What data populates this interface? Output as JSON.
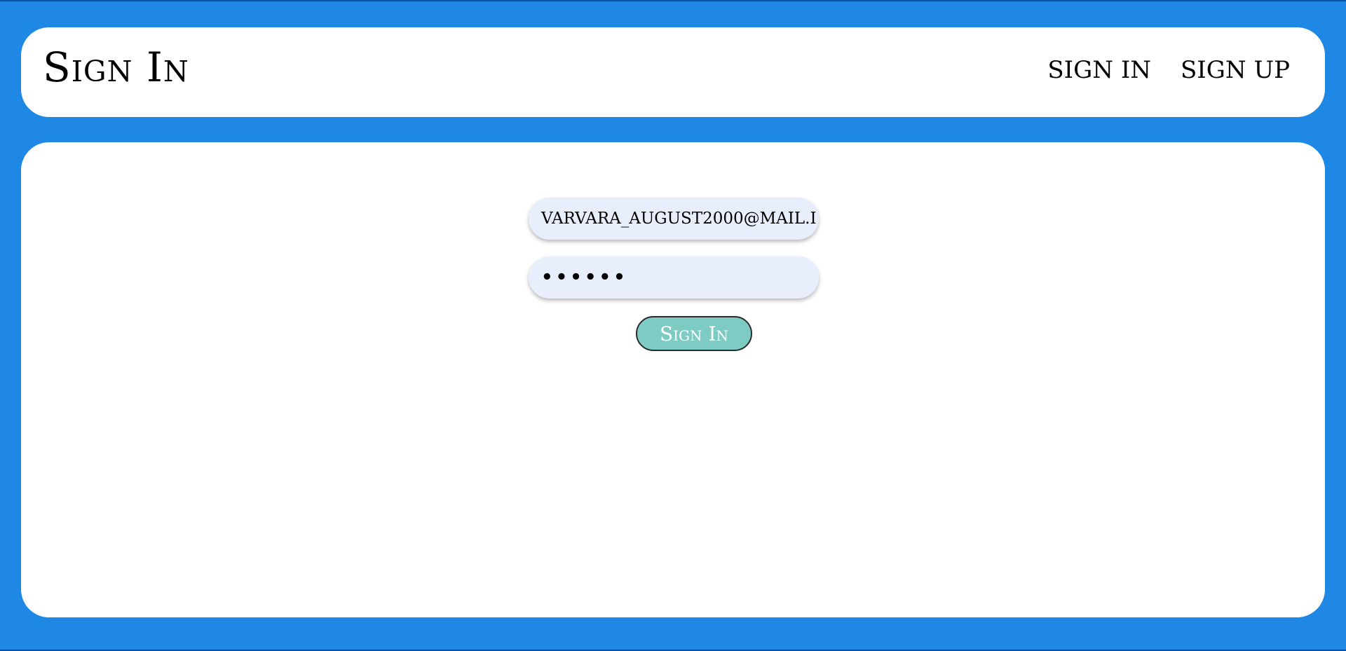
{
  "header": {
    "title": "Sign In",
    "nav": [
      {
        "label": "SIGN IN"
      },
      {
        "label": "SIGN UP"
      }
    ]
  },
  "form": {
    "email_value": "VARVARA_AUGUST2000@MAIL.I",
    "password_value": "••••••",
    "submit_label": "Sign In"
  },
  "colors": {
    "background": "#1f88e5",
    "panel": "#ffffff",
    "input_bg": "#e8eefb",
    "button_bg": "#7ecbc3"
  }
}
